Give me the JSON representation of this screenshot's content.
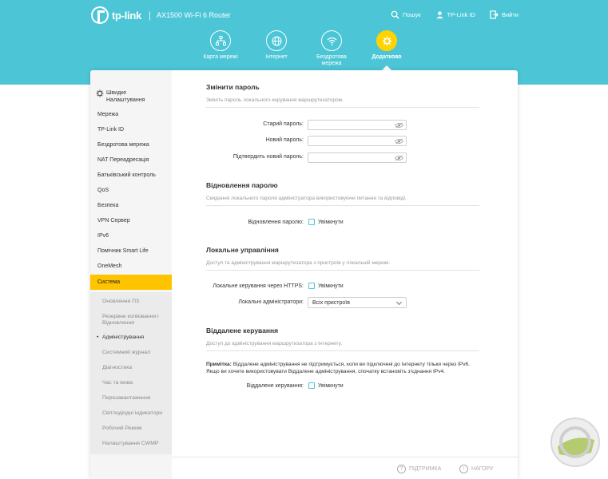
{
  "header": {
    "brand": "tp-link",
    "model": "AX1500 Wi-Fi 6 Router",
    "links": [
      {
        "label": "Пошук",
        "icon": "search-icon"
      },
      {
        "label": "TP-Link ID",
        "icon": "user-icon"
      },
      {
        "label": "Вийти",
        "icon": "logout-icon"
      }
    ],
    "colors": {
      "bar": "#4cc6d6",
      "accent": "#ffd200"
    }
  },
  "nav": {
    "items": [
      {
        "label": "Карта мережі",
        "icon": "network-map-icon"
      },
      {
        "label": "Інтернет",
        "icon": "globe-icon"
      },
      {
        "label": "Бездротова мережа",
        "icon": "wifi-icon"
      },
      {
        "label": "Додатково",
        "icon": "gear-icon",
        "active": true
      }
    ]
  },
  "sidebar": {
    "quick": "Швидке Налаштування",
    "items": [
      "Мережа",
      "TP-Link ID",
      "Бездротова мережа",
      "NAT Переадресація",
      "Батьківський контроль",
      "QoS",
      "Безпека",
      "VPN Сервер",
      "IPv6",
      "Помічник Smart Life",
      "OneMesh",
      "Система"
    ],
    "sub_items": [
      "Оновлення ПЗ",
      "Резервне копіювання і Відновлення",
      "Адміністрування",
      "Системний журнал",
      "Діагностика",
      "Час та мова",
      "Перезавантаження",
      "Світлодіодні індикатори",
      "Робочий Режим",
      "Налаштування CWMP"
    ]
  },
  "sections": {
    "password": {
      "title": "Змінити пароль",
      "desc": "Змініть пароль локального керування маршрутизатором.",
      "old": "Старий пароль:",
      "new": "Новий пароль:",
      "confirm": "Підтвердить новий пароль:"
    },
    "recovery": {
      "title": "Відновлення паролю",
      "desc": "Скидання локального пароля адміністратора використовуючи питання та відповіді.",
      "label": "Відновлення паролю:",
      "check": "Увімкнути"
    },
    "local": {
      "title": "Локальне управління",
      "desc": "Доступ та адміністрування маршрутизатора з пристроїв у локальній мережі.",
      "https_label": "Локальне керування через HTTPS:",
      "https_check": "Увімкнути",
      "admins_label": "Локальні адміністратори:",
      "admins_value": "Всіх пристроїв"
    },
    "remote": {
      "title": "Віддалене керування",
      "desc": "Доступ до адміністрування маршрутизатора з Інтернету.",
      "note_bold": "Примітка:",
      "note_text": " Віддалене адміністрування не підтримується, коли ви підключені до Інтернету тільки через IPv6. Якщо ви хочете використовувати Віддалене адміністрування, спочатку встановіть з'єднання IPv4.",
      "label": "Віддалене керування:",
      "check": "Увімкнути"
    }
  },
  "footer": {
    "support": "ПІДТРИМКА",
    "top": "НАГОРУ"
  }
}
